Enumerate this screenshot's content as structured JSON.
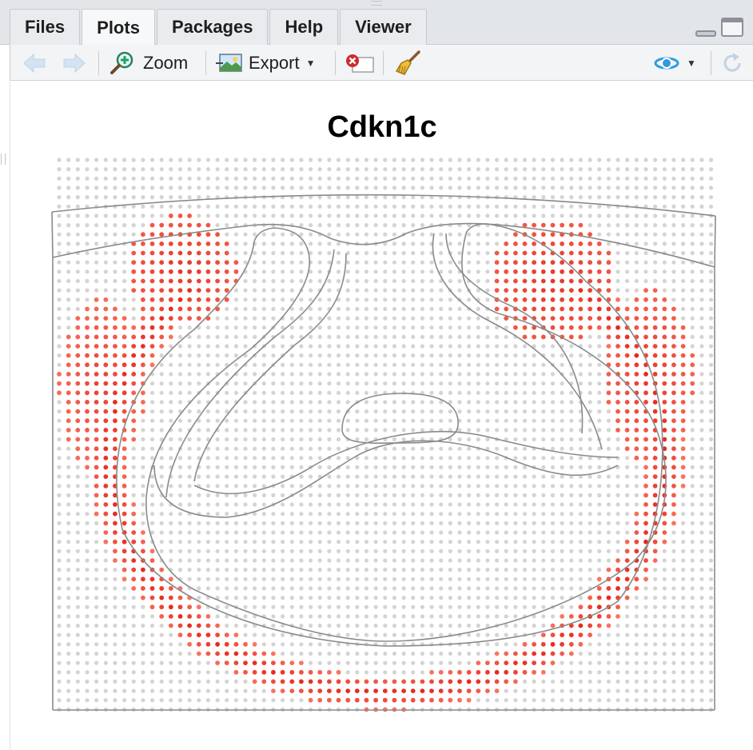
{
  "tabs": [
    {
      "label": "Files",
      "active": false
    },
    {
      "label": "Plots",
      "active": true
    },
    {
      "label": "Packages",
      "active": false
    },
    {
      "label": "Help",
      "active": false
    },
    {
      "label": "Viewer",
      "active": false
    }
  ],
  "toolbar": {
    "zoom_label": "Zoom",
    "export_label": "Export"
  },
  "colors": {
    "accent_blue": "#2f9be0",
    "dot_background": "#d4d4d4",
    "dot_high": "#e8281c",
    "dot_low": "#ff8870",
    "outline": "#8a8a8a"
  },
  "chart_data": {
    "type": "scatter",
    "title": "Cdkn1c",
    "xlabel": "",
    "ylabel": "",
    "grid": "regular spot grid (spatial expression map)",
    "legend": "none",
    "value_scale": "grey = no expression, light red to red = increasing expression",
    "overlay": "tissue section outline"
  }
}
